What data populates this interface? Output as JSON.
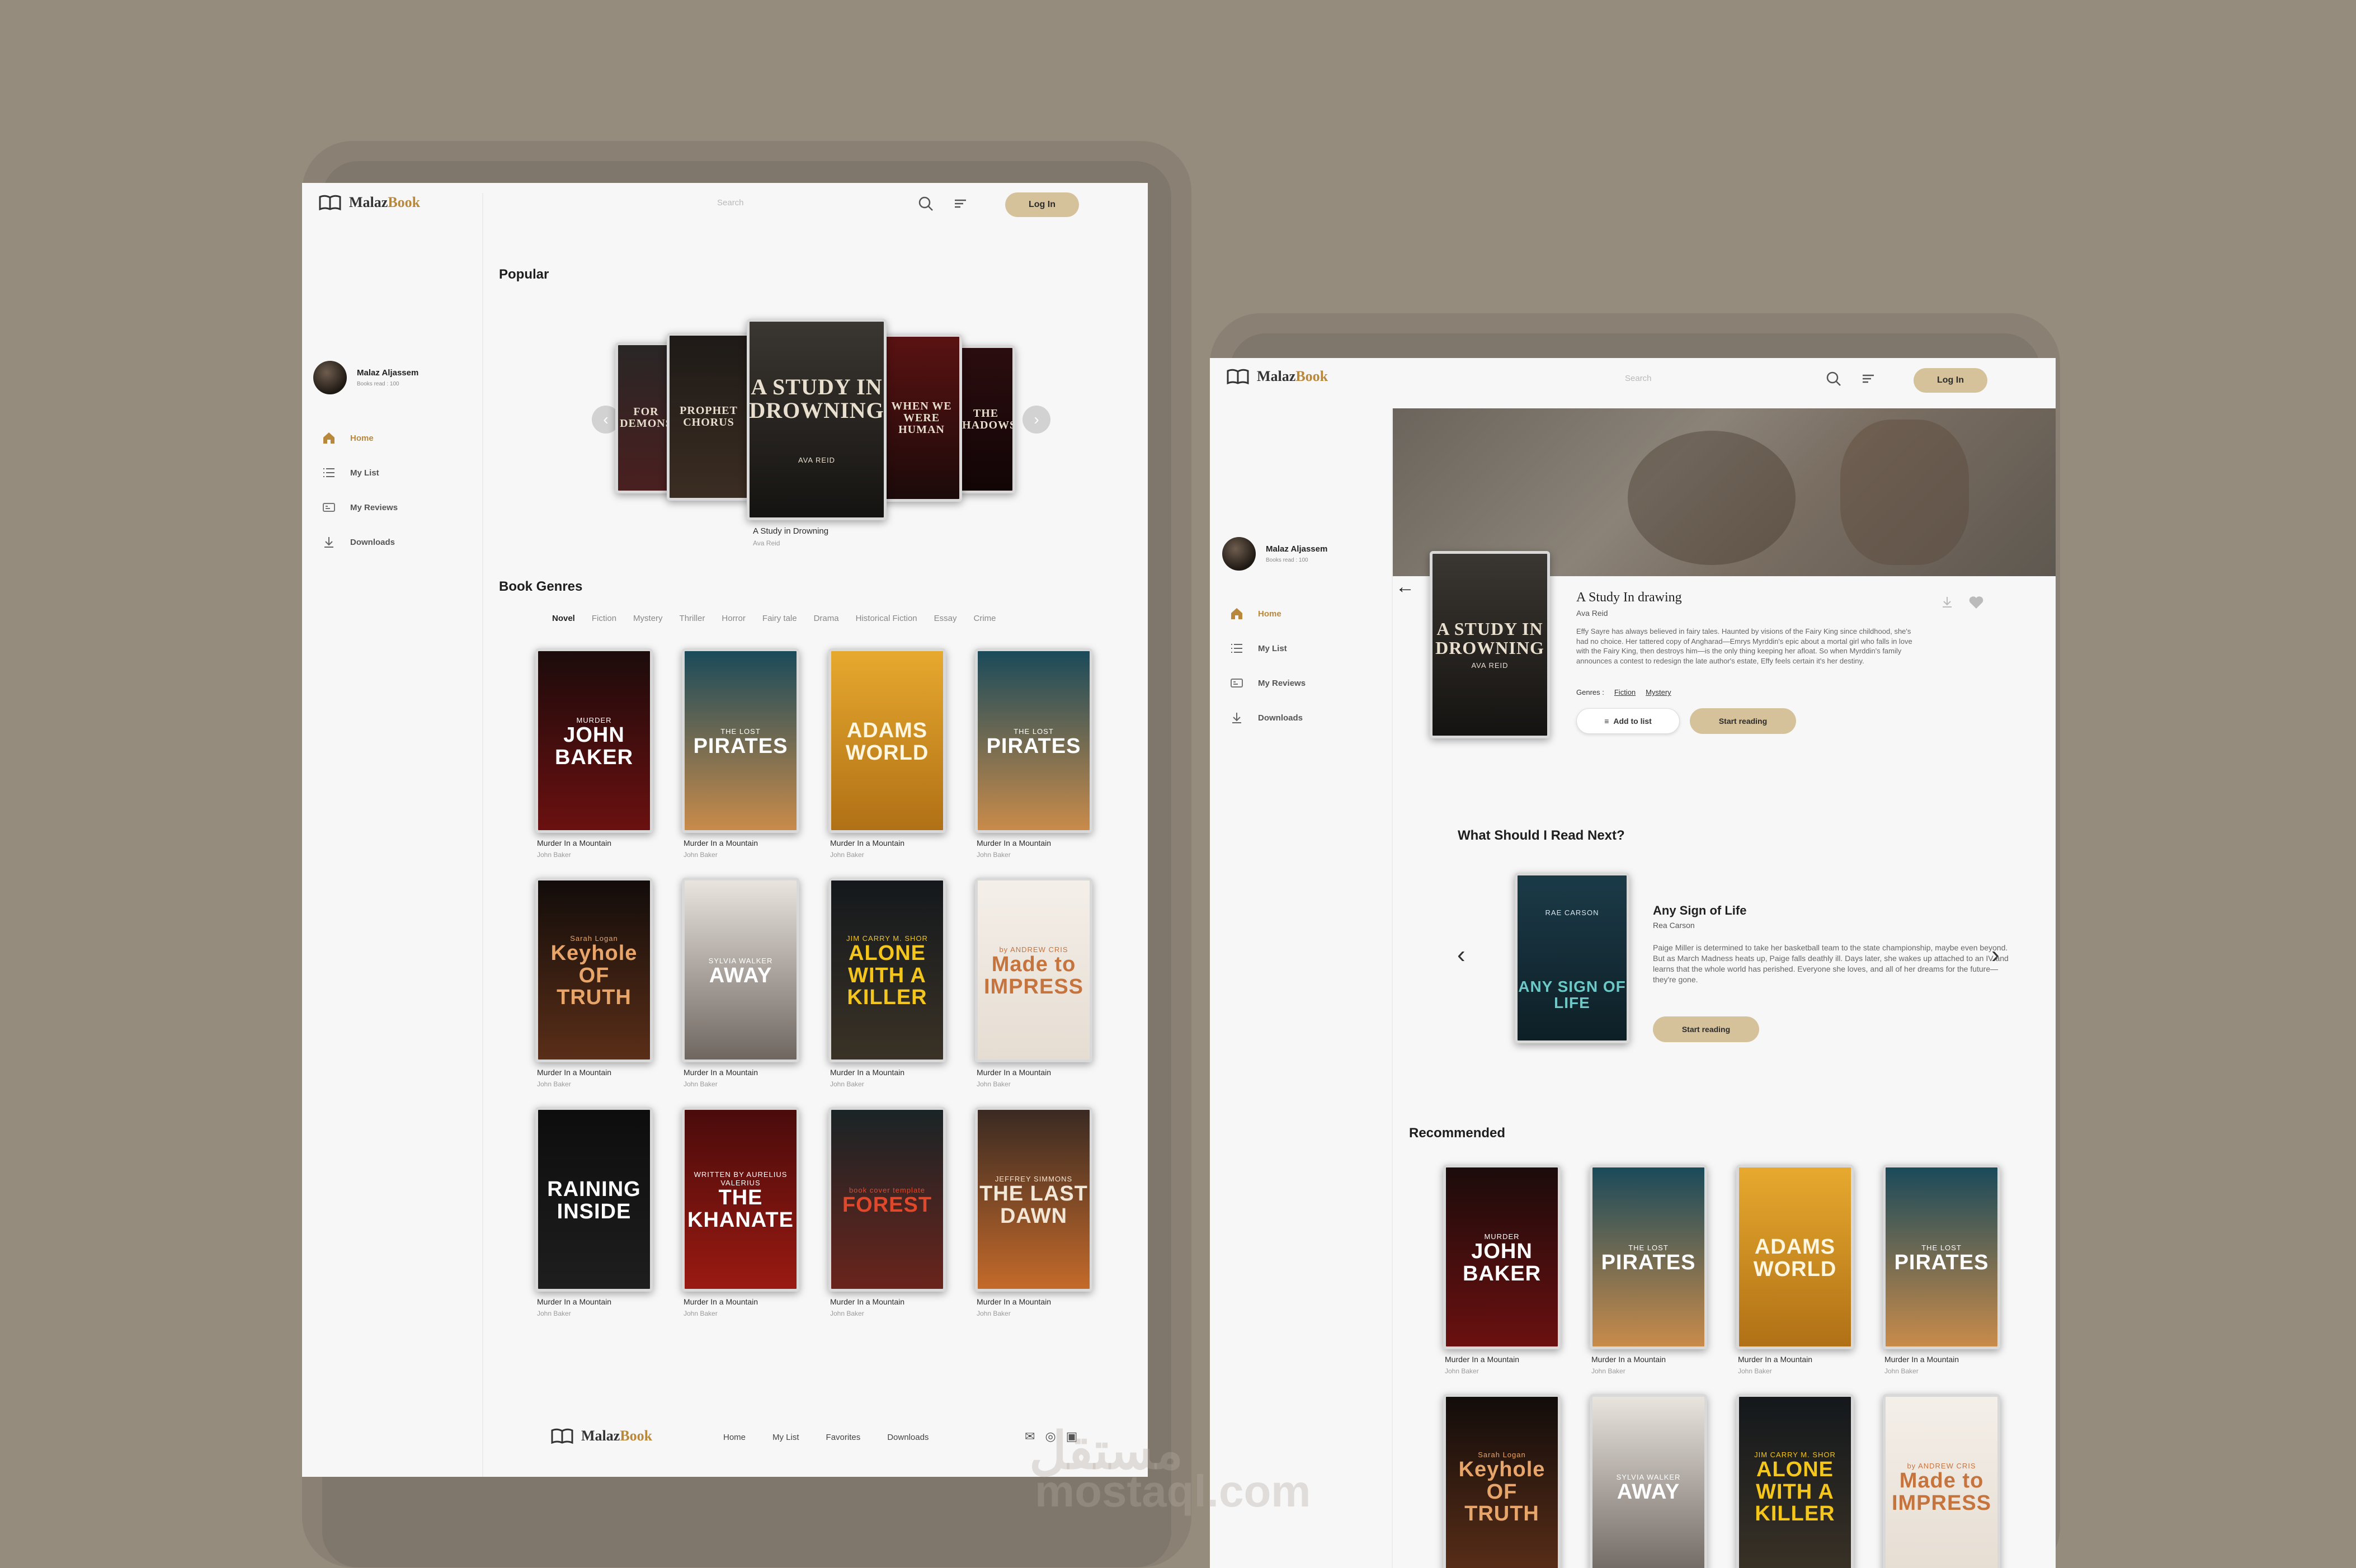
{
  "brand": {
    "part1": "Malaz",
    "part2": "Book"
  },
  "header": {
    "search_placeholder": "Search",
    "login_label": "Log In"
  },
  "profile": {
    "name": "Malaz Aljassem",
    "stat": "Books read : 100"
  },
  "nav": [
    {
      "label": "Home",
      "icon": "home-icon"
    },
    {
      "label": "My List",
      "icon": "list-icon"
    },
    {
      "label": "My Reviews",
      "icon": "reviews-icon"
    },
    {
      "label": "Downloads",
      "icon": "download-icon"
    }
  ],
  "popular": {
    "title": "Popular",
    "featured_title": "A Study in Drowning",
    "featured_author": "Ava Reid",
    "covers": [
      {
        "t": "FOR DEMONS",
        "c1": "#2a2626",
        "c2": "#4a1f1f"
      },
      {
        "t": "PROPHET CHORUS",
        "c1": "#1e1a17",
        "c2": "#3b2d22"
      },
      {
        "t": "A STUDY IN DROWNING",
        "a": "AVA REID",
        "c1": "#3a3631",
        "c2": "#151311"
      },
      {
        "t": "WHEN WE WERE HUMAN",
        "c1": "#5a1212",
        "c2": "#1c0a0a"
      },
      {
        "t": "THE SHADOWS",
        "c1": "#2b0d0f",
        "c2": "#120506"
      }
    ]
  },
  "genres_section": {
    "title": "Book Genres",
    "genres": [
      "Novel",
      "Fiction",
      "Mystery",
      "Thriller",
      "Horror",
      "Fairy tale",
      "Drama",
      "Historical Fiction",
      "Essay",
      "Crime"
    ]
  },
  "books": [
    {
      "t": "JOHN BAKER",
      "s": "MURDER",
      "bg": "#1c0b0b",
      "bg2": "#6b1010",
      "tc": "#ffffff",
      "cap": "Murder In a Mountain",
      "au": "John Baker"
    },
    {
      "t": "PIRATES",
      "s": "THE LOST",
      "bg": "#1a4a5a",
      "bg2": "#c98b4a",
      "tc": "#ffffff",
      "cap": "Murder In a Mountain",
      "au": "John Baker"
    },
    {
      "t": "ADAMS WORLD",
      "s": "",
      "bg": "#e7a92e",
      "bg2": "#b07016",
      "tc": "#fff6e0",
      "cap": "Murder In a Mountain",
      "au": "John Baker"
    },
    {
      "t": "PIRATES",
      "s": "THE LOST",
      "bg": "#1a4a5a",
      "bg2": "#c98b4a",
      "tc": "#ffffff",
      "cap": "Murder In a Mountain",
      "au": "John Baker"
    },
    {
      "t": "Keyhole OF TRUTH",
      "s": "Sarah Logan",
      "bg": "#120c0a",
      "bg2": "#5a2e18",
      "tc": "#e8a56a",
      "cap": "Murder In a Mountain",
      "au": "John Baker"
    },
    {
      "t": "AWAY",
      "s": "SYLVIA WALKER",
      "bg": "#e9e4de",
      "bg2": "#6f6660",
      "tc": "#ffffff",
      "cap": "Murder In a Mountain",
      "au": "John Baker"
    },
    {
      "t": "ALONE WITH A KILLER",
      "s": "JIM CARRY M. SHOR",
      "bg": "#14181c",
      "bg2": "#3a3226",
      "tc": "#f4c51a",
      "cap": "Murder In a Mountain",
      "au": "John Baker"
    },
    {
      "t": "Made to IMPRESS",
      "s": "by ANDREW CRIS",
      "bg": "#f4efe9",
      "bg2": "#e6ddd2",
      "tc": "#c6743e",
      "cap": "Murder In a Mountain",
      "au": "John Baker"
    },
    {
      "t": "RAINING INSIDE",
      "s": "",
      "bg": "#0d0d0d",
      "bg2": "#1e1e1e",
      "tc": "#ffffff",
      "cap": "Murder In a Mountain",
      "au": "John Baker"
    },
    {
      "t": "THE KHANATE",
      "s": "WRITTEN BY AURELIUS VALERIUS",
      "bg": "#4a0b0b",
      "bg2": "#9a1a12",
      "tc": "#ffffff",
      "cap": "Murder In a Mountain",
      "au": "John Baker"
    },
    {
      "t": "FOREST",
      "s": "book cover template",
      "bg": "#1a2426",
      "bg2": "#6a241c",
      "tc": "#e0482c",
      "cap": "Murder In a Mountain",
      "au": "John Baker"
    },
    {
      "t": "THE LAST DAWN",
      "s": "JEFFREY SIMMONS",
      "bg": "#3a2a22",
      "bg2": "#c46a2a",
      "tc": "#f2e6d6",
      "cap": "Murder In a Mountain",
      "au": "John Baker"
    }
  ],
  "footer": {
    "links": [
      "Home",
      "My List",
      "Favorites",
      "Downloads"
    ]
  },
  "detail": {
    "title": "A Study In drawing",
    "author": "Ava Reid",
    "description": "Effy Sayre has always believed in fairy tales. Haunted by visions of the Fairy King since childhood, she's had no choice. Her tattered copy of Angharad—Emrys Myrddin's epic about a mortal girl who falls in love with the Fairy King, then destroys him—is the only thing keeping her afloat. So when Myrddin's family announces a contest to redesign the late author's estate, Effy feels certain it's her destiny.",
    "genres_label": "Genres :",
    "genres": [
      "Fiction",
      "Mystery"
    ],
    "add_label": "Add to list",
    "start_label": "Start reading",
    "cover_title": "A STUDY IN DROWNING",
    "cover_author": "AVA REID"
  },
  "next": {
    "title": "What Should I Read Next?",
    "book_title": "Any Sign of Life",
    "book_author": "Rea Carson",
    "description": "Paige Miller is determined to take her basketball team to the state championship, maybe even beyond. But as March Madness heats up, Paige falls deathly ill. Days later, she wakes up attached to an IV and learns that the whole world has perished. Everyone she loves, and all of her dreams for the future—they're gone.",
    "start_label": "Start reading",
    "cover_title": "ANY SIGN OF LIFE",
    "cover_author": "RAE CARSON"
  },
  "recommended": {
    "title": "Recommended"
  }
}
